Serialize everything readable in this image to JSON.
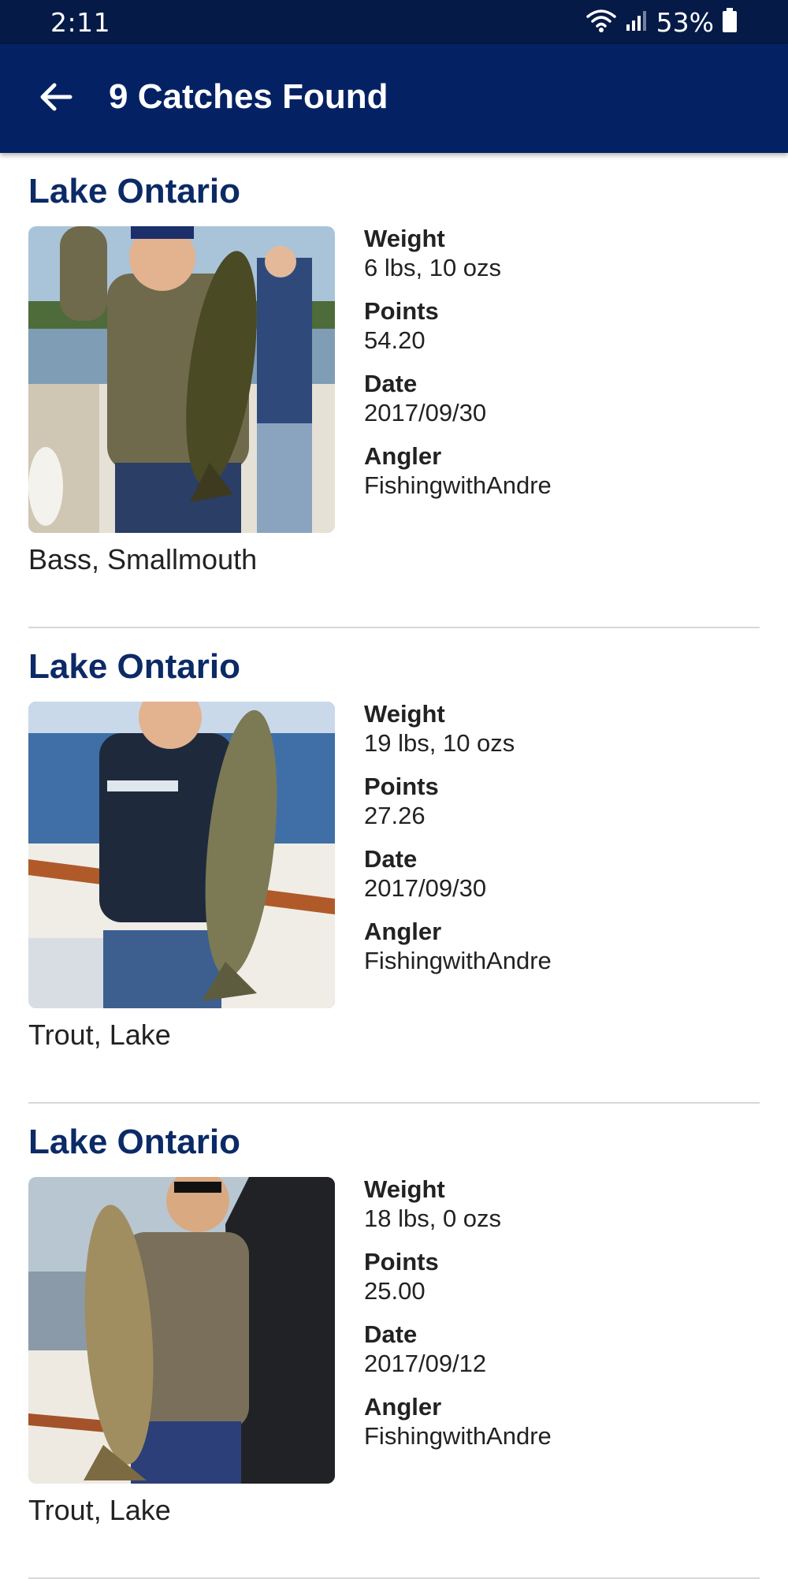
{
  "status_bar": {
    "time": "2:11",
    "battery": "53%",
    "icons": [
      "wifi-icon",
      "signal-icon",
      "battery-icon"
    ]
  },
  "app_bar": {
    "title": "9 Catches Found",
    "back_icon": "arrow-left-icon"
  },
  "colors": {
    "status_bar": "#061a47",
    "app_bar": "#042263",
    "lake_title": "#0b2a66"
  },
  "catches": [
    {
      "lake": "Lake Ontario",
      "species": "Bass, Smallmouth",
      "weight_label": "Weight",
      "weight": "6 lbs, 10 ozs",
      "points_label": "Points",
      "points": "54.20",
      "date_label": "Date",
      "date": "2017/09/30",
      "angler_label": "Angler",
      "angler": "FishingwithAndre"
    },
    {
      "lake": "Lake Ontario",
      "species": "Trout, Lake",
      "weight_label": "Weight",
      "weight": "19 lbs, 10 ozs",
      "points_label": "Points",
      "points": "27.26",
      "date_label": "Date",
      "date": "2017/09/30",
      "angler_label": "Angler",
      "angler": "FishingwithAndre"
    },
    {
      "lake": "Lake Ontario",
      "species": "Trout, Lake",
      "weight_label": "Weight",
      "weight": "18 lbs, 0 ozs",
      "points_label": "Points",
      "points": "25.00",
      "date_label": "Date",
      "date": "2017/09/12",
      "angler_label": "Angler",
      "angler": "FishingwithAndre"
    }
  ]
}
